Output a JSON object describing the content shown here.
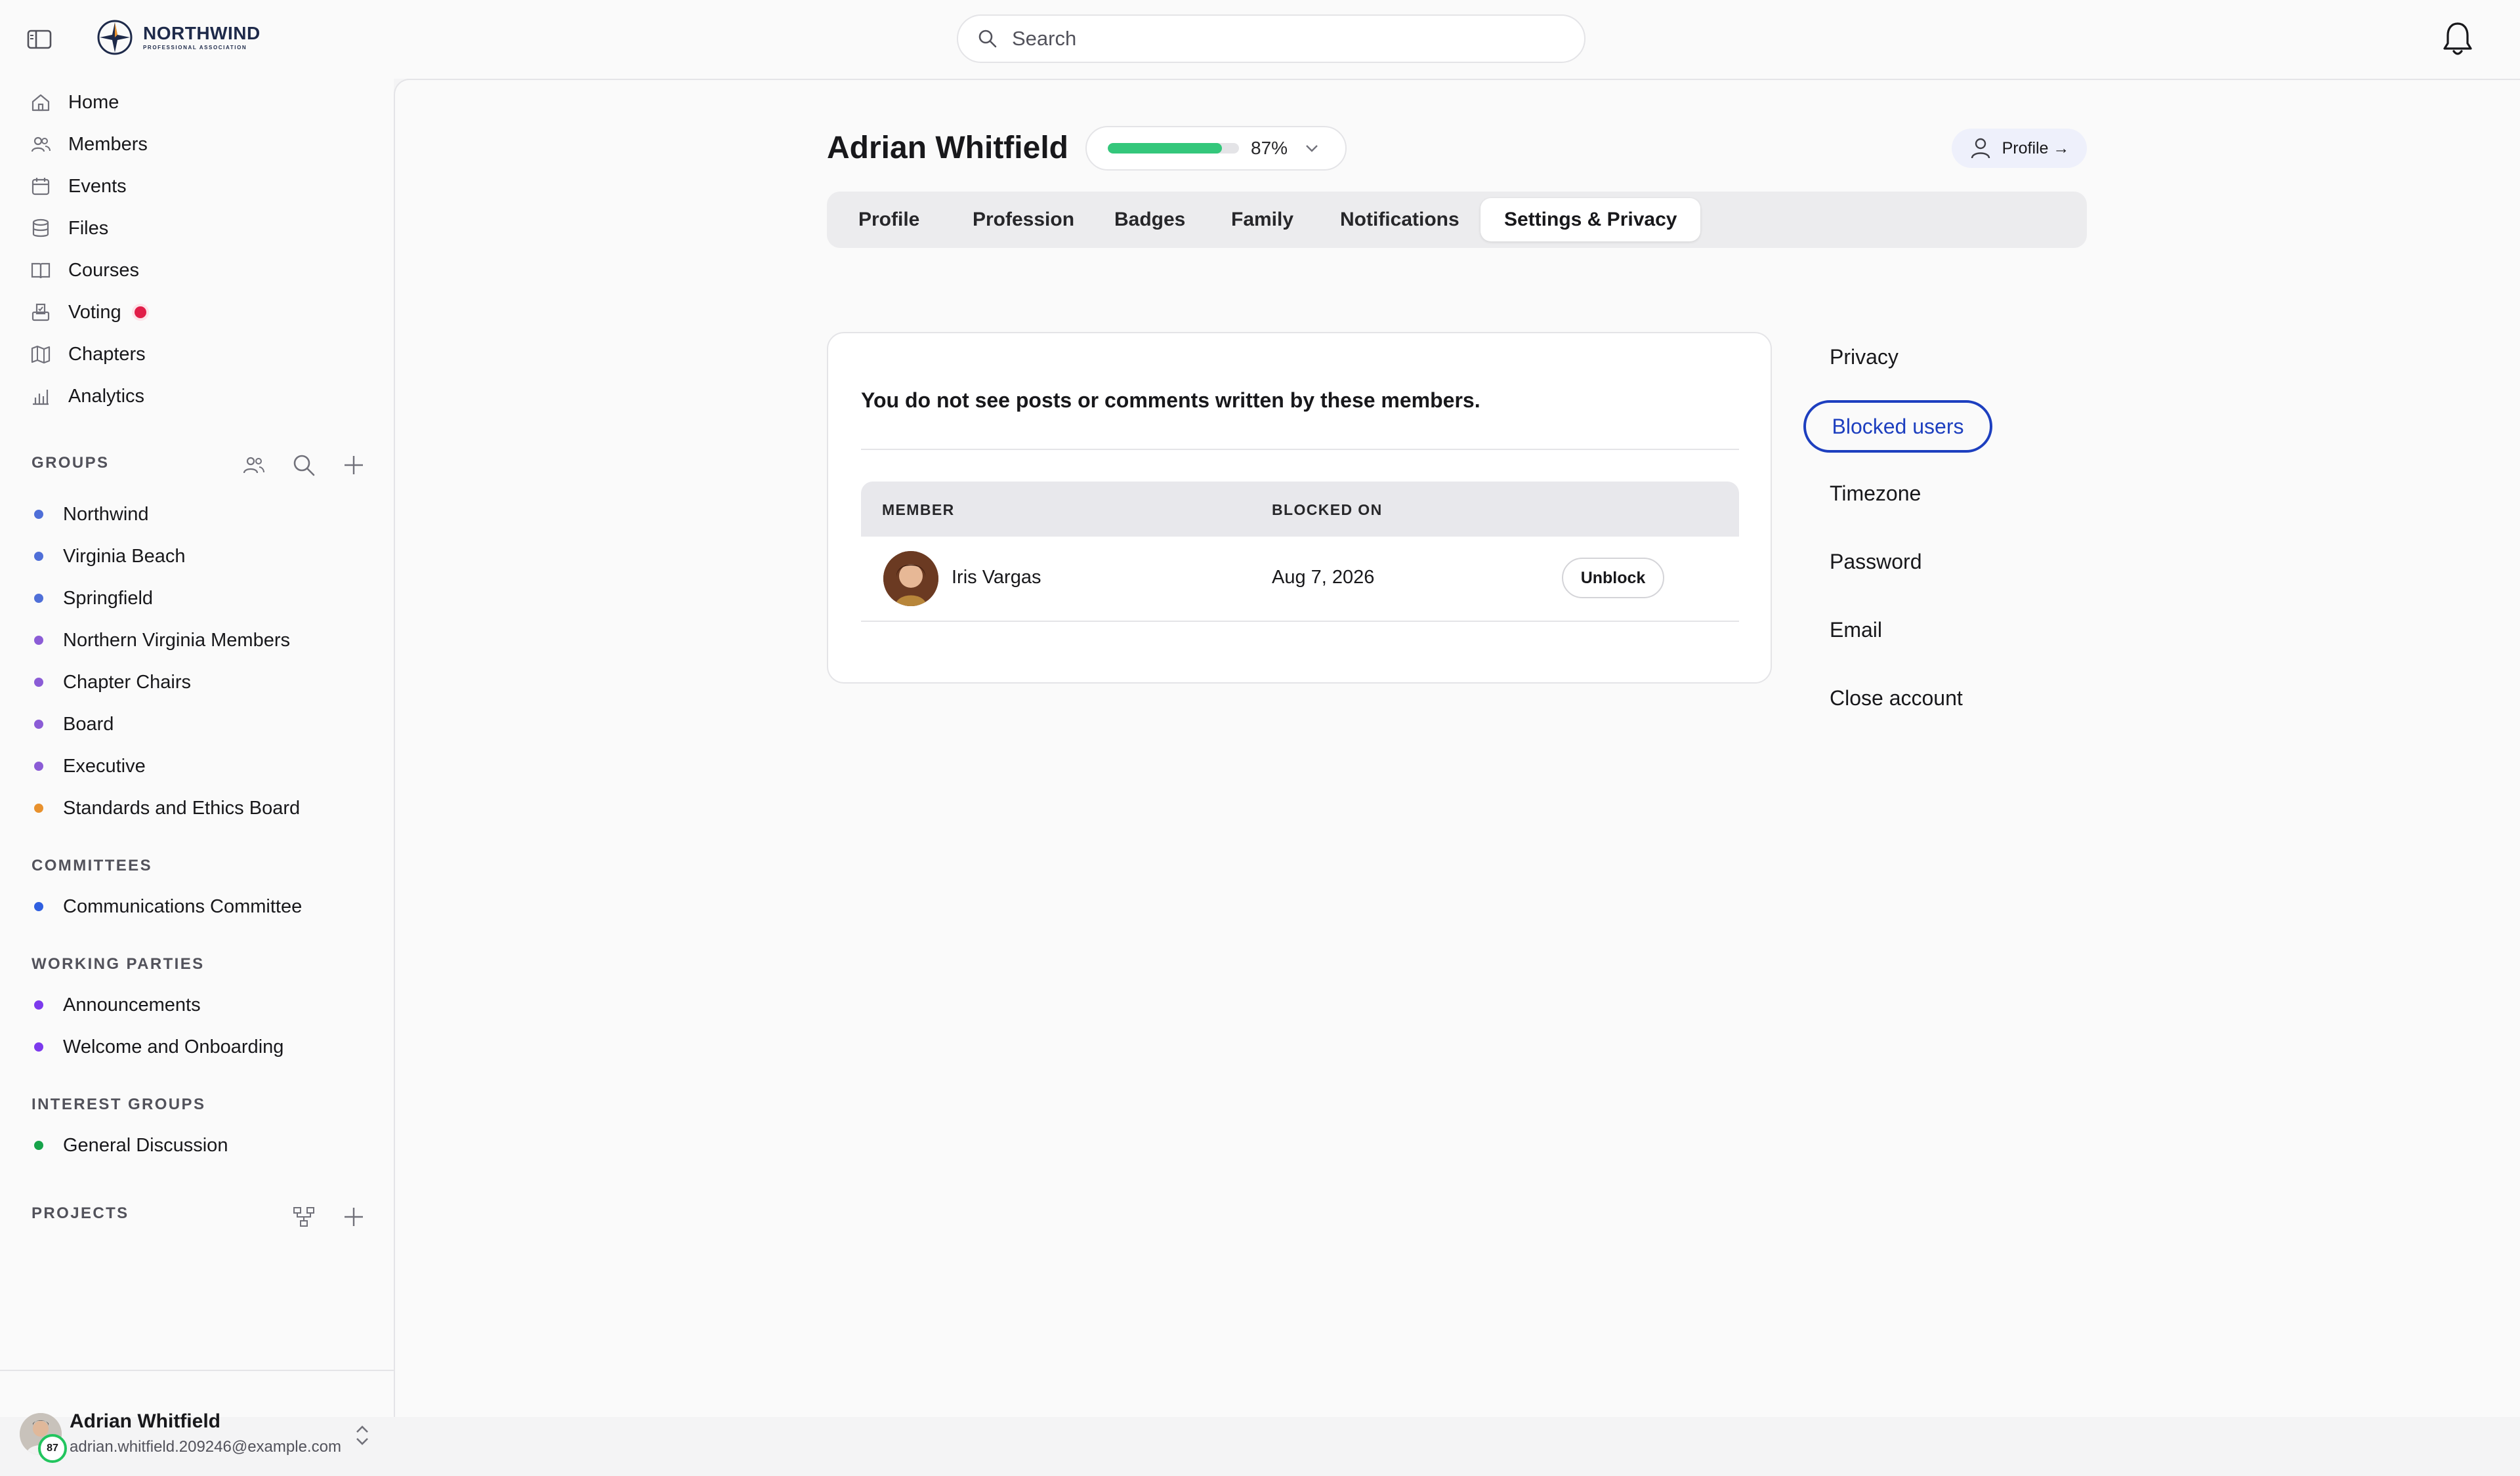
{
  "brand": {
    "name": "NORTHWIND",
    "tagline": "PROFESSIONAL ASSOCIATION"
  },
  "search": {
    "placeholder": "Search"
  },
  "sidebar": {
    "nav": [
      {
        "label": "Home",
        "icon": "home-icon"
      },
      {
        "label": "Members",
        "icon": "members-icon"
      },
      {
        "label": "Events",
        "icon": "calendar-icon"
      },
      {
        "label": "Files",
        "icon": "database-icon"
      },
      {
        "label": "Courses",
        "icon": "book-icon"
      },
      {
        "label": "Voting",
        "icon": "ballot-icon",
        "indicator": "red-dot"
      },
      {
        "label": "Chapters",
        "icon": "map-icon"
      },
      {
        "label": "Analytics",
        "icon": "chart-icon"
      }
    ],
    "groups": {
      "title": "GROUPS",
      "items": [
        {
          "label": "Northwind",
          "color": "#4f6fd8"
        },
        {
          "label": "Virginia Beach",
          "color": "#4f6fd8"
        },
        {
          "label": "Springfield",
          "color": "#4f6fd8"
        },
        {
          "label": "Northern Virginia Members",
          "color": "#8b5cd6"
        },
        {
          "label": "Chapter Chairs",
          "color": "#8b5cd6"
        },
        {
          "label": "Board",
          "color": "#8b5cd6"
        },
        {
          "label": "Executive",
          "color": "#8b5cd6"
        },
        {
          "label": "Standards and Ethics Board",
          "color": "#e8912d"
        }
      ]
    },
    "committees": {
      "title": "COMMITTEES",
      "items": [
        {
          "label": "Communications Committee",
          "color": "#2f5fe0"
        }
      ]
    },
    "working_parties": {
      "title": "WORKING PARTIES",
      "items": [
        {
          "label": "Announcements",
          "color": "#7c3aed"
        },
        {
          "label": "Welcome and Onboarding",
          "color": "#7c3aed"
        }
      ]
    },
    "interest_groups": {
      "title": "INTEREST GROUPS",
      "items": [
        {
          "label": "General Discussion",
          "color": "#16a34a"
        }
      ]
    },
    "projects": {
      "title": "PROJECTS"
    },
    "user": {
      "name": "Adrian Whitfield",
      "email": "adrian.whitfield.209246@example.com",
      "badge": "87"
    }
  },
  "header": {
    "title": "Adrian Whitfield",
    "completion_label": "87%",
    "completion_fraction": 0.87,
    "profile_button": "Profile →"
  },
  "tabs": [
    {
      "label": "Profile"
    },
    {
      "label": "Profession"
    },
    {
      "label": "Badges"
    },
    {
      "label": "Family"
    },
    {
      "label": "Notifications"
    },
    {
      "label": "Settings & Privacy",
      "active": true
    }
  ],
  "blocked": {
    "message": "You do not see posts or comments written by these members.",
    "columns": [
      "MEMBER",
      "BLOCKED ON"
    ],
    "rows": [
      {
        "member": "Iris Vargas",
        "blocked_on": "Aug 7, 2026",
        "action": "Unblock"
      }
    ]
  },
  "settings_menu": [
    {
      "label": "Privacy"
    },
    {
      "label": "Blocked users",
      "active": true
    },
    {
      "label": "Timezone"
    },
    {
      "label": "Password"
    },
    {
      "label": "Email"
    },
    {
      "label": "Close account"
    }
  ],
  "colors": {
    "accent": "#1d3fbf",
    "progress": "#34c77b",
    "alert": "#e11d48",
    "online": "#22c55e"
  }
}
